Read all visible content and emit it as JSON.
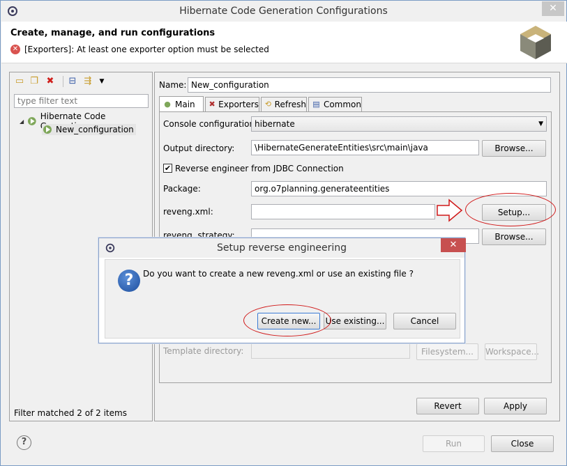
{
  "window": {
    "title": "Hibernate Code Generation Configurations",
    "close_glyph": "✕"
  },
  "header": {
    "title": "Create, manage, and run configurations",
    "error": "[Exporters]: At least one exporter option must be selected"
  },
  "left_panel": {
    "filter_placeholder": "type filter text",
    "tree": [
      {
        "label": "Hibernate Code Generation",
        "expanded": true
      },
      {
        "label": "New_configuration",
        "selected": true
      }
    ],
    "status": "Filter matched 2 of 2 items",
    "toolbar_icons": [
      "new-launch-config-icon",
      "duplicate-icon",
      "delete-icon",
      "collapse-all-icon",
      "filter-icon",
      "dropdown-icon"
    ]
  },
  "config": {
    "name_label": "Name:",
    "name_value": "New_configuration",
    "tabs": [
      {
        "label": "Main",
        "icon": "main-tab-icon",
        "active": true
      },
      {
        "label": "Exporters",
        "icon": "exporters-tab-icon",
        "active": false
      },
      {
        "label": "Refresh",
        "icon": "refresh-tab-icon",
        "active": false
      },
      {
        "label": "Common",
        "icon": "common-tab-icon",
        "active": false
      }
    ],
    "console_label": "Console configuration:",
    "console_value": "hibernate",
    "output_label": "Output directory:",
    "output_value": "\\HibernateGenerateEntities\\src\\main\\java",
    "browse_label": "Browse...",
    "reverse_checkbox_label": "Reverse engineer from JDBC Connection",
    "reverse_checked": true,
    "package_label": "Package:",
    "package_value": "org.o7planning.generateentities",
    "reveng_xml_label": "reveng.xml:",
    "reveng_xml_value": "",
    "setup_label": "Setup...",
    "reveng_strategy_label": "reveng. strategy:",
    "browse2_label": "Browse...",
    "template_label": "Template directory:",
    "template_value": "",
    "filesystem_label": "Filesystem...",
    "workspace_label": "Workspace...",
    "revert_label": "Revert",
    "apply_label": "Apply"
  },
  "footer": {
    "help_glyph": "?",
    "run_label": "Run",
    "close_label": "Close"
  },
  "dialog": {
    "title": "Setup reverse engineering",
    "close_glyph": "✕",
    "message": "Do you want to create a new reveng.xml or use an existing file ?",
    "question_glyph": "?",
    "create_label": "Create new...",
    "existing_label": "Use existing...",
    "cancel_label": "Cancel"
  },
  "colors": {
    "annotation": "#d01818",
    "accent": "#1d4e9e",
    "error": "#d9534f"
  }
}
